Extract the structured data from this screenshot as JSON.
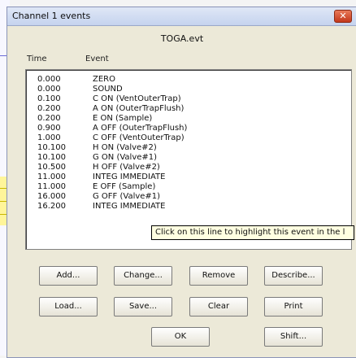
{
  "window": {
    "title": "Channel 1 events",
    "close_glyph": "✕"
  },
  "file_name": "TOGA.evt",
  "columns": {
    "time": "Time",
    "event": "Event"
  },
  "events": [
    {
      "time": "0.000",
      "event": "ZERO"
    },
    {
      "time": "0.000",
      "event": "SOUND"
    },
    {
      "time": "0.100",
      "event": "C ON (VentOuterTrap)"
    },
    {
      "time": "0.200",
      "event": "A ON (OuterTrapFlush)"
    },
    {
      "time": "0.200",
      "event": "E ON (Sample)"
    },
    {
      "time": "0.900",
      "event": "A OFF (OuterTrapFlush)"
    },
    {
      "time": "1.000",
      "event": "C OFF (VentOuterTrap)"
    },
    {
      "time": "10.100",
      "event": "H ON (Valve#2)"
    },
    {
      "time": "10.100",
      "event": "G ON (Valve#1)"
    },
    {
      "time": "10.500",
      "event": "H OFF (Valve#2)"
    },
    {
      "time": "11.000",
      "event": "INTEG IMMEDIATE"
    },
    {
      "time": "11.000",
      "event": "E OFF (Sample)"
    },
    {
      "time": "16.000",
      "event": "G OFF (Valve#1)"
    },
    {
      "time": "16.200",
      "event": "INTEG IMMEDIATE"
    }
  ],
  "tooltip": "Click on this line to highlight this event in the l",
  "buttons": {
    "add": "Add...",
    "change": "Change...",
    "remove": "Remove",
    "describe": "Describe...",
    "load": "Load...",
    "save": "Save...",
    "clear": "Clear",
    "print": "Print",
    "ok": "OK",
    "shift": "Shift..."
  }
}
